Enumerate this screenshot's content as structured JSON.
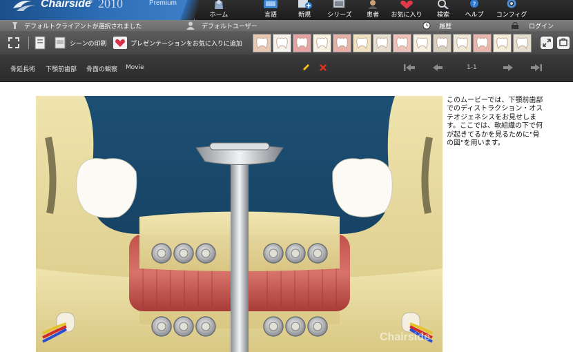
{
  "app": {
    "logo_text": "Chairside",
    "logo_mark": "®",
    "year": "2010",
    "edition": "Premium"
  },
  "nav": [
    {
      "label": "ホーム",
      "icon": "home-icon"
    },
    {
      "label": "言語",
      "icon": "language-icon"
    },
    {
      "label": "新規",
      "icon": "new-icon"
    },
    {
      "label": "シリーズ",
      "icon": "series-icon"
    },
    {
      "label": "患者",
      "icon": "patient-icon"
    },
    {
      "label": "お気に入り",
      "icon": "favorites-icon"
    },
    {
      "label": "検索",
      "icon": "search-icon"
    },
    {
      "label": "ヘルプ",
      "icon": "help-icon"
    },
    {
      "label": "コンフィグ",
      "icon": "config-icon"
    }
  ],
  "status": {
    "client": "デフォルトクライアントが選択されました",
    "user": "デフォルトユーザー",
    "history": "履歴",
    "login": "ログイン"
  },
  "toolbar": {
    "print_scene": "シーンの印刷",
    "add_favorite": "プレゼンテーションをお気に入りに追加",
    "thumbnail_count": 14
  },
  "playbar": {
    "breadcrumb": [
      "骨延長術",
      "下顎前歯部",
      "骨面の観察",
      "Movie"
    ],
    "page_indicator": "1-1"
  },
  "content": {
    "description": "このムービーでは、下顎前歯部でのディストラクション・オステオジェネシスをお見せします。ここでは、軟組織の下で何が起きてるかを見るために\"骨の図\"を用います。",
    "watermark": "Chairside"
  },
  "colors": {
    "brand_blue": "#2e6fb8",
    "scene_background": "#174a6e",
    "bone": "#e8dca3",
    "muscle": "#c94a45"
  }
}
